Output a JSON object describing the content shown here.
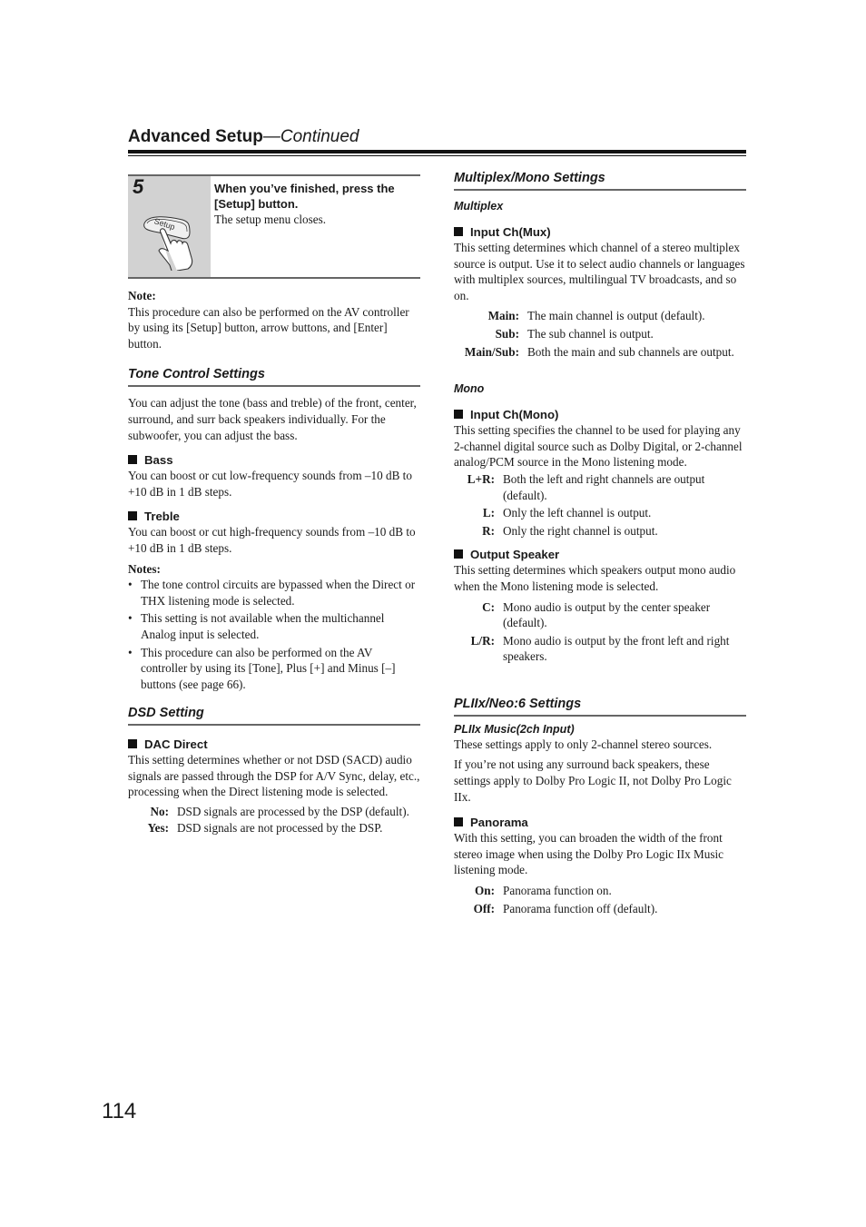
{
  "header": {
    "title": "Advanced Setup",
    "title_suffix": "—Continued"
  },
  "step": {
    "number": "5",
    "instruction": "When you’ve finished, press the [Setup] button.",
    "result": "The setup menu closes.",
    "icon_label": "Setup"
  },
  "note": {
    "label": "Note:",
    "text": "This procedure can also be performed on the AV controller by using its [Setup] button, arrow buttons, and [Enter] button."
  },
  "tone_control": {
    "title": "Tone Control Settings",
    "intro": "You can adjust the tone (bass and treble) of the front, center, surround, and surr back speakers individually. For the subwoofer, you can adjust the bass.",
    "bass": {
      "heading": "Bass",
      "text": "You can boost or cut low-frequency sounds from –10 dB to +10 dB in 1 dB steps."
    },
    "treble": {
      "heading": "Treble",
      "text": "You can boost or cut high-frequency sounds from –10 dB to +10 dB in 1 dB steps."
    },
    "notes_label": "Notes:",
    "notes": [
      "The tone control circuits are bypassed when the Direct or THX listening mode is selected.",
      "This setting is not available when the multichannel Analog input is selected.",
      "This procedure can also be performed on the AV controller by using its [Tone], Plus [+] and Minus [–] buttons (see page 66)."
    ]
  },
  "dsd": {
    "title": "DSD Setting",
    "dac_direct": {
      "heading": "DAC Direct",
      "text": "This setting determines whether or not DSD (SACD) audio signals are passed through the DSP for A/V Sync, delay, etc., processing when the Direct listening mode is selected.",
      "options": [
        {
          "key": "No:",
          "value": "DSD signals are processed by the DSP (default)."
        },
        {
          "key": "Yes:",
          "value": "DSD signals are not processed by the DSP."
        }
      ]
    }
  },
  "multiplex_mono": {
    "title": "Multiplex/Mono Settings",
    "multiplex_subtitle": "Multiplex",
    "input_mux": {
      "heading": "Input Ch(Mux)",
      "text": "This setting determines which channel of a stereo multiplex source is output. Use it to select audio channels or languages with multiplex sources, multilingual TV broadcasts, and so on.",
      "options": [
        {
          "key": "Main:",
          "value": "The main channel is output (default)."
        },
        {
          "key": "Sub:",
          "value": "The sub channel is output."
        },
        {
          "key": "Main/Sub:",
          "value": "Both the main and sub channels are output."
        }
      ]
    },
    "mono_subtitle": "Mono",
    "input_mono": {
      "heading": "Input Ch(Mono)",
      "text": "This setting specifies the channel to be used for playing any 2-channel digital source such as Dolby Digital, or 2-channel analog/PCM source in the Mono listening mode.",
      "options": [
        {
          "key": "L+R:",
          "value": "Both the left and right channels are output (default)."
        },
        {
          "key": "L:",
          "value": "Only the left channel is output."
        },
        {
          "key": "R:",
          "value": "Only the right channel is output."
        }
      ]
    },
    "output_speaker": {
      "heading": "Output Speaker",
      "text": "This setting determines which speakers output mono audio when the Mono listening mode is selected.",
      "options": [
        {
          "key": "C:",
          "value": "Mono audio is output by the center speaker (default)."
        },
        {
          "key": "L/R:",
          "value": "Mono audio is output by the front left and right speakers."
        }
      ]
    }
  },
  "pliix_neo": {
    "title": "PLIIx/Neo:6 Settings",
    "subtitle": "PLIIx Music(2ch Input)",
    "intro1": "These settings apply to only 2-channel stereo sources.",
    "intro2": "If you’re not using any surround back speakers, these settings apply to Dolby Pro Logic II, not Dolby Pro Logic IIx.",
    "panorama": {
      "heading": "Panorama",
      "text": "With this setting, you can broaden the width of the front stereo image when using the Dolby Pro Logic IIx Music listening mode.",
      "options": [
        {
          "key": "On:",
          "value": "Panorama function on."
        },
        {
          "key": "Off:",
          "value": "Panorama function off (default)."
        }
      ]
    }
  },
  "page_number": "114"
}
